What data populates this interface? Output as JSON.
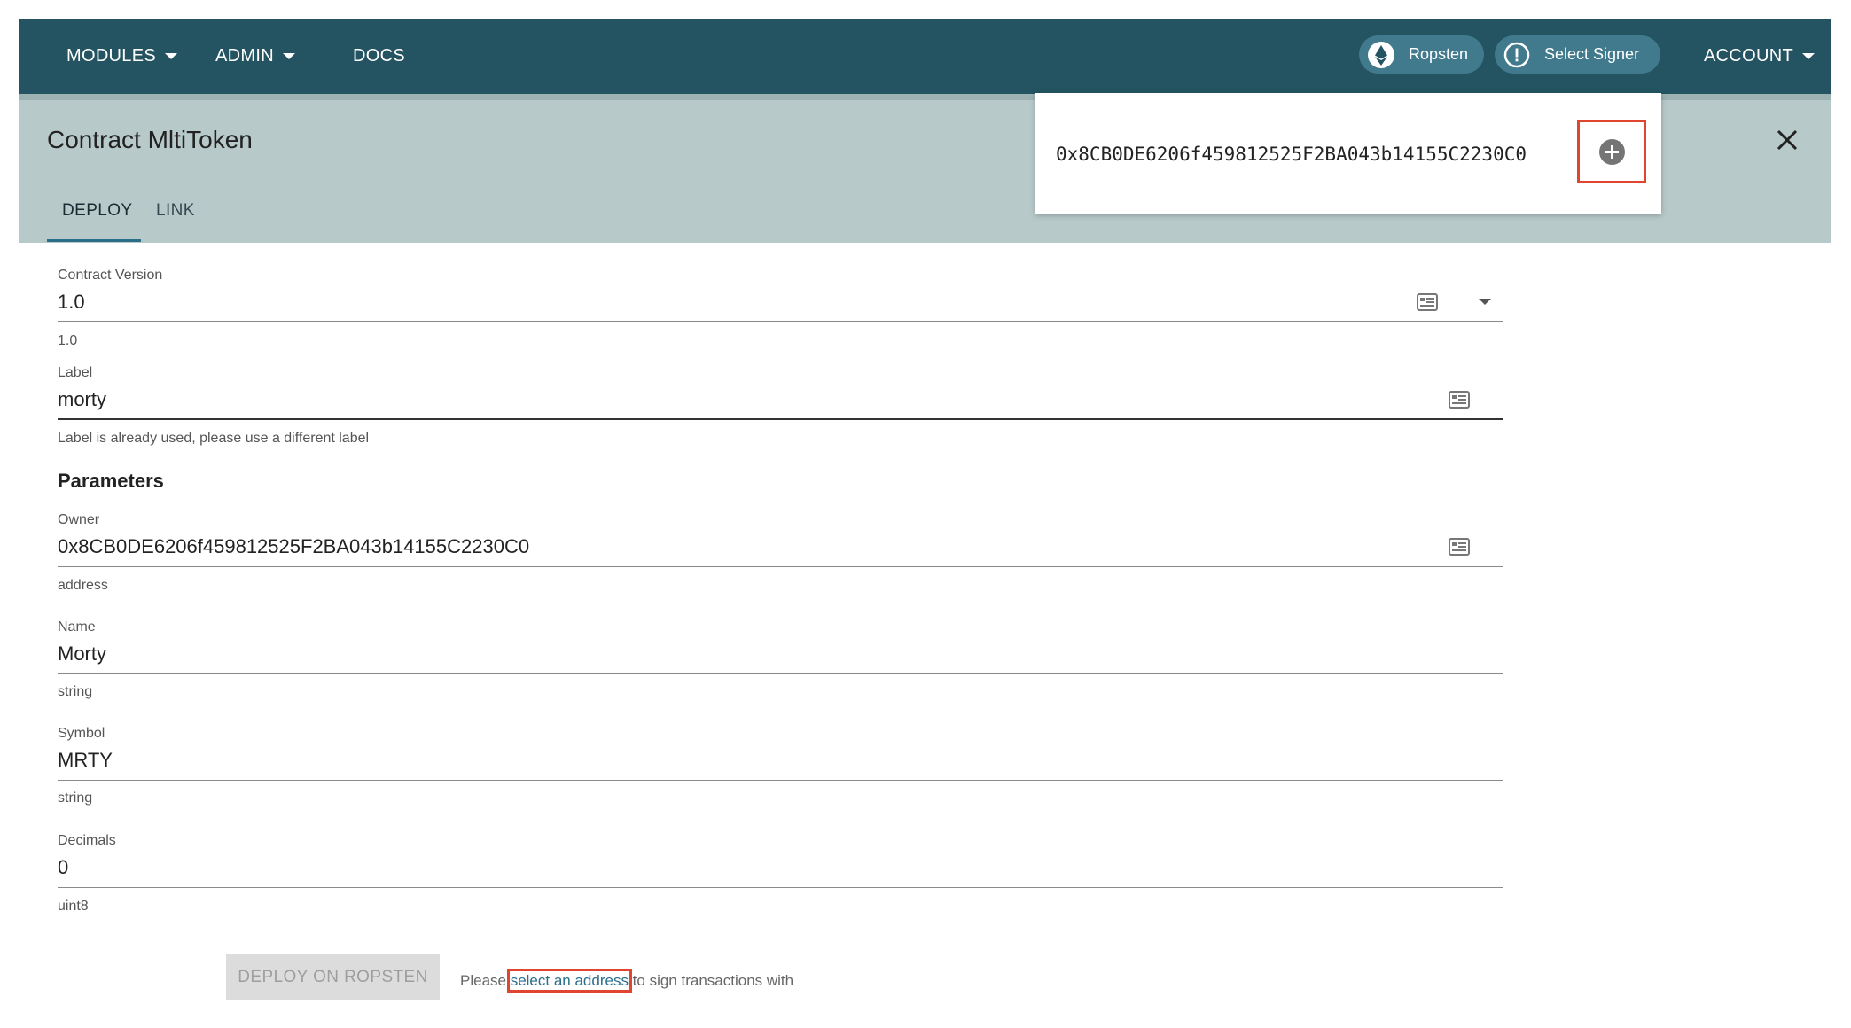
{
  "nav": {
    "modules_label": "MODULES",
    "admin_label": "ADMIN",
    "docs_label": "DOCS",
    "network_label": "Ropsten",
    "network_icon": "ethereum-icon",
    "signer_label": "Select Signer",
    "signer_icon": "alert-circle-icon",
    "account_label": "ACCOUNT"
  },
  "header": {
    "title": "Contract MltiToken",
    "tabs": [
      {
        "label": "DEPLOY",
        "active": true
      },
      {
        "label": "LINK",
        "active": false
      }
    ]
  },
  "popover": {
    "address": "0x8CB0DE6206f459812525F2BA043b14155C2230C0",
    "add_icon": "plus-circle-icon"
  },
  "form": {
    "contract_version": {
      "label": "Contract Version",
      "value": "1.0",
      "helper": "1.0"
    },
    "label": {
      "label": "Label",
      "value": "morty",
      "helper": "Label is already used, please use a different label"
    },
    "parameters_title": "Parameters",
    "owner": {
      "label": "Owner",
      "value": "0x8CB0DE6206f459812525F2BA043b14155C2230C0",
      "helper": "address"
    },
    "name": {
      "label": "Name",
      "value": "Morty",
      "helper": "string"
    },
    "symbol": {
      "label": "Symbol",
      "value": "MRTY",
      "helper": "string"
    },
    "decimals": {
      "label": "Decimals",
      "value": "0",
      "helper": "uint8"
    }
  },
  "footer": {
    "deploy_label": "DEPLOY ON ROPSTEN",
    "prefix": "Please ",
    "link_text": "select an address",
    "suffix": " to sign transactions with"
  },
  "colors": {
    "navbar": "#245461",
    "header_band": "#b7c9c8",
    "accent": "#2b6e8a",
    "highlight": "#e0452f"
  }
}
